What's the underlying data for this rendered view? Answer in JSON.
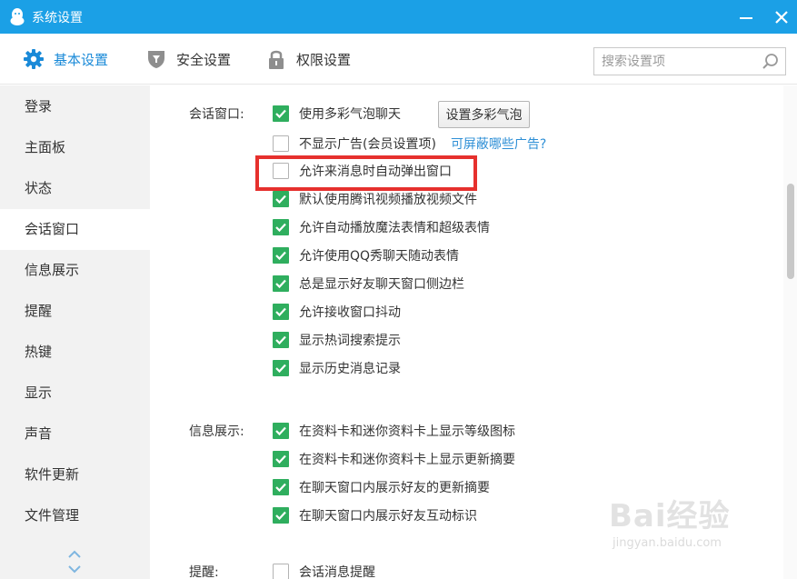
{
  "window": {
    "title": "系统设置",
    "minimize_label": "−",
    "close_label": "✕"
  },
  "tabs": [
    {
      "label": "基本设置",
      "icon": "gear-icon",
      "active": true
    },
    {
      "label": "安全设置",
      "icon": "shield-icon",
      "active": false
    },
    {
      "label": "权限设置",
      "icon": "lock-icon",
      "active": false
    }
  ],
  "search": {
    "placeholder": "搜索设置项",
    "value": ""
  },
  "sidebar": {
    "items": [
      {
        "label": "登录"
      },
      {
        "label": "主面板"
      },
      {
        "label": "状态"
      },
      {
        "label": "会话窗口",
        "active": true
      },
      {
        "label": "信息展示"
      },
      {
        "label": "提醒"
      },
      {
        "label": "热键"
      },
      {
        "label": "显示"
      },
      {
        "label": "声音"
      },
      {
        "label": "软件更新"
      },
      {
        "label": "文件管理"
      }
    ]
  },
  "sections": {
    "chat": {
      "label": "会话窗口:",
      "bubble_button": "设置多彩气泡",
      "ad_link": "可屏蔽哪些广告?",
      "options": [
        {
          "text": "使用多彩气泡聊天",
          "checked": true
        },
        {
          "text": "不显示广告(会员设置项)",
          "checked": false
        },
        {
          "text": "允许来消息时自动弹出窗口",
          "checked": false
        },
        {
          "text": "默认使用腾讯视频播放视频文件",
          "checked": true
        },
        {
          "text": "允许自动播放魔法表情和超级表情",
          "checked": true
        },
        {
          "text": "允许使用QQ秀聊天随动表情",
          "checked": true
        },
        {
          "text": "总是显示好友聊天窗口侧边栏",
          "checked": true
        },
        {
          "text": "允许接收窗口抖动",
          "checked": true
        },
        {
          "text": "显示热词搜索提示",
          "checked": true
        },
        {
          "text": "显示历史消息记录",
          "checked": true
        }
      ]
    },
    "info": {
      "label": "信息展示:",
      "options": [
        {
          "text": "在资料卡和迷你资料卡上显示等级图标",
          "checked": true
        },
        {
          "text": "在资料卡和迷你资料卡上显示更新摘要",
          "checked": true
        },
        {
          "text": "在聊天窗口内展示好友的更新摘要",
          "checked": true
        },
        {
          "text": "在聊天窗口内展示好友互动标识",
          "checked": true
        }
      ]
    },
    "remind": {
      "label": "提醒:",
      "options": [
        {
          "text": "会话消息提醒",
          "checked": false
        }
      ]
    }
  },
  "watermark": {
    "big": "Bai经验",
    "small": "jingyan.baidu.com"
  },
  "colors": {
    "accent": "#1ba0e6",
    "check": "#2fae5e",
    "highlight": "#e6302d",
    "link": "#2e8fd6"
  }
}
